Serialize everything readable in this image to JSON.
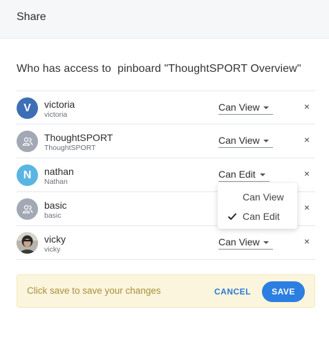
{
  "dialog": {
    "title": "Share"
  },
  "heading": "Who has access to  pinboard \"ThoughtSPORT Overview\"",
  "rows": [
    {
      "name": "victoria",
      "sub": "victoria",
      "avatar": "V",
      "avatar_type": "letter",
      "avatar_color": "#3e6eb5",
      "permission": "Can View",
      "remove": "×"
    },
    {
      "name": "ThoughtSPORT",
      "sub": "ThoughtSPORT",
      "avatar": "group-icon",
      "avatar_type": "group",
      "avatar_color": "#a2a8b4",
      "permission": "Can View",
      "remove": "×"
    },
    {
      "name": "nathan",
      "sub": "Nathan",
      "avatar": "N",
      "avatar_type": "letter",
      "avatar_color": "#5ab5e2",
      "permission": "Can Edit",
      "remove": "×"
    },
    {
      "name": "basic",
      "sub": "basic",
      "avatar": "group-icon",
      "avatar_type": "group",
      "avatar_color": "#a2a8b4",
      "permission": "",
      "remove": "×"
    },
    {
      "name": "vicky",
      "sub": "vicky",
      "avatar": "photo",
      "avatar_type": "photo",
      "avatar_color": "#8e8a86",
      "permission": "Can View",
      "remove": "×"
    }
  ],
  "permission_menu": {
    "items": [
      {
        "label": "Can View",
        "checked": false
      },
      {
        "label": "Can Edit",
        "checked": true
      }
    ]
  },
  "footer": {
    "message": "Click save to save your changes",
    "cancel_label": "CANCEL",
    "save_label": "SAVE"
  },
  "colors": {
    "accent": "#2c7fe0",
    "footer_bg": "#fbf5dd",
    "footer_text": "#a98f3c"
  }
}
